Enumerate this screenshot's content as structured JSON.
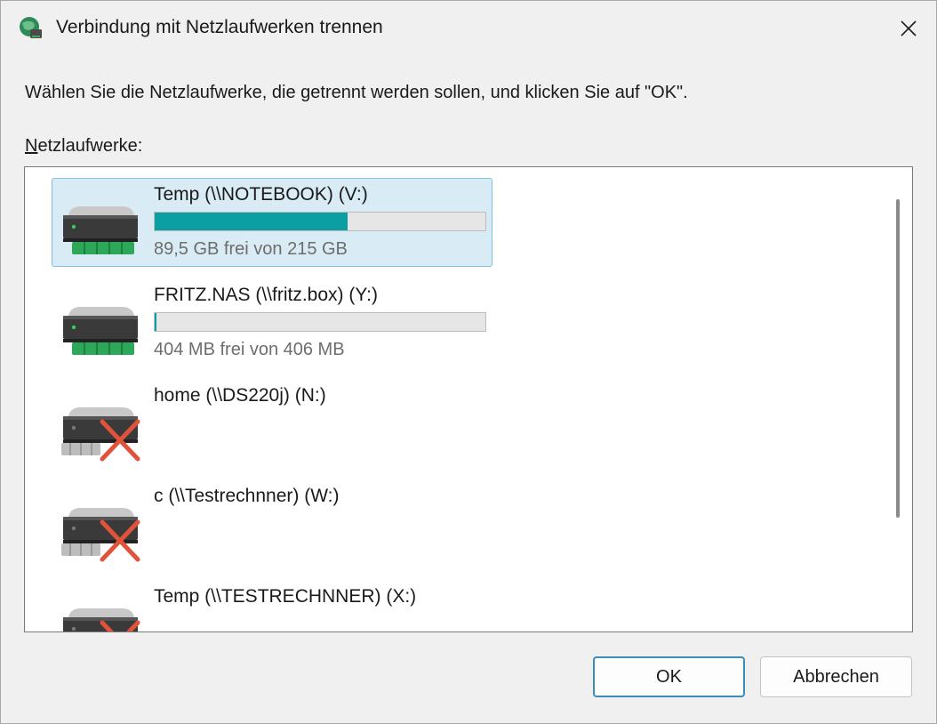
{
  "window": {
    "title": "Verbindung mit Netzlaufwerken trennen",
    "close_glyph": "✕"
  },
  "instruction": "Wählen Sie die Netzlaufwerke, die getrennt werden sollen, und klicken Sie auf \"OK\".",
  "list": {
    "label_accel": "N",
    "label_rest": "etzlaufwerke:",
    "drives": [
      {
        "name": "Temp (\\\\NOTEBOOK) (V:)",
        "free": "89,5 GB frei von 215 GB",
        "used_fraction": 0.584,
        "status": "connected",
        "selected": true,
        "icon": "network-drive-icon"
      },
      {
        "name": "FRITZ.NAS (\\\\fritz.box) (Y:)",
        "free": "404 MB frei von 406 MB",
        "used_fraction": 0.005,
        "status": "connected",
        "selected": false,
        "icon": "network-drive-icon"
      },
      {
        "name": "home (\\\\DS220j) (N:)",
        "status": "disconnected",
        "selected": false,
        "icon": "disconnected-drive-icon"
      },
      {
        "name": "c (\\\\Testrechnner) (W:)",
        "status": "disconnected",
        "selected": false,
        "icon": "disconnected-drive-icon"
      },
      {
        "name": "Temp (\\\\TESTRECHNNER) (X:)",
        "status": "disconnected",
        "selected": false,
        "icon": "disconnected-drive-icon"
      }
    ]
  },
  "buttons": {
    "ok": "OK",
    "cancel": "Abbrechen"
  },
  "colors": {
    "bar_fill": "#0b9ea3",
    "selection_bg": "#d9ebf4",
    "selection_border": "#7ec4dd",
    "default_button_border": "#3a8fb7"
  }
}
